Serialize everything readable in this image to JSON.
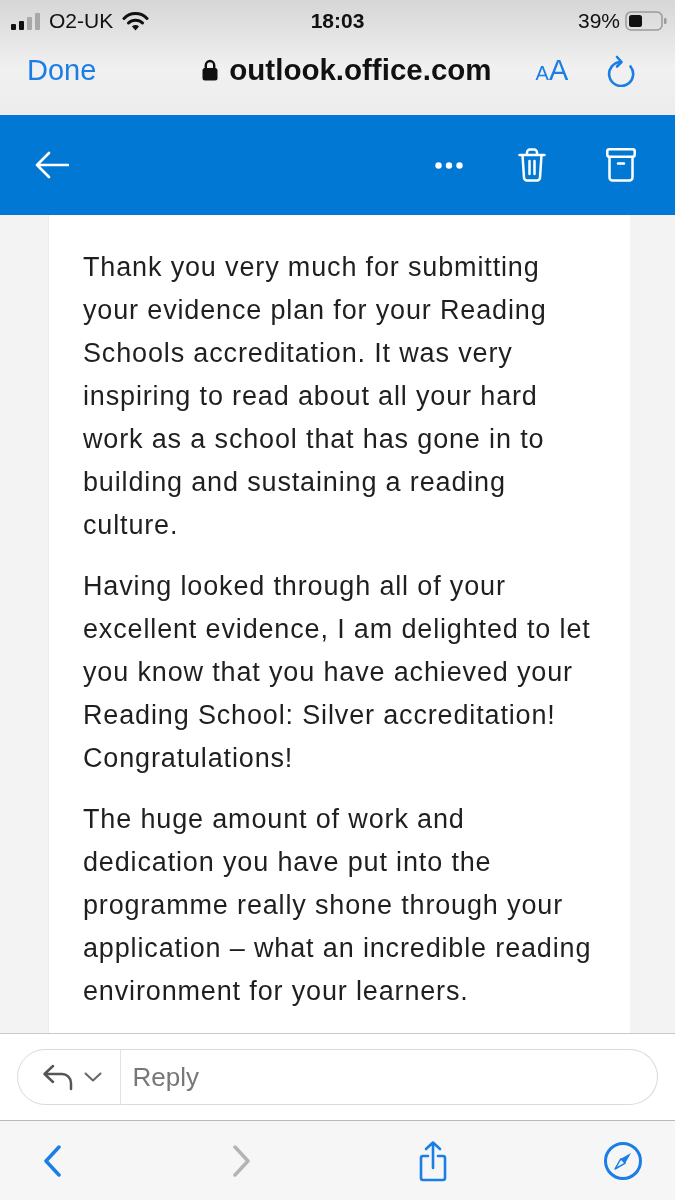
{
  "status_bar": {
    "carrier": "O2-UK",
    "time": "18:03",
    "battery": "39%"
  },
  "browser_bar": {
    "done": "Done",
    "url": "outlook.office.com",
    "text_size": "AA"
  },
  "email": {
    "paragraphs": [
      [
        "Thank you very much for submitting",
        "your evidence plan for your Reading",
        "Schools accreditation. It was very",
        "inspiring to read about all your hard",
        "work as a school that has gone in to",
        "building and sustaining a reading",
        "culture."
      ],
      [
        "Having looked through all of your",
        "excellent evidence, I am delighted to let",
        "you know that you have achieved your",
        "Reading School: Silver accreditation!",
        "Congratulations!"
      ],
      [
        "The huge amount of work and",
        "dedication you have put into the",
        "programme really shone through your",
        "application – what an incredible reading",
        "environment for your learners."
      ]
    ]
  },
  "reply": {
    "placeholder": "Reply"
  },
  "bottom_toolbar": [
    {
      "kind": "back",
      "disabled": false
    },
    {
      "kind": "forward",
      "disabled": true
    },
    {
      "kind": "share",
      "disabled": false
    },
    {
      "kind": "compass",
      "disabled": false
    }
  ]
}
